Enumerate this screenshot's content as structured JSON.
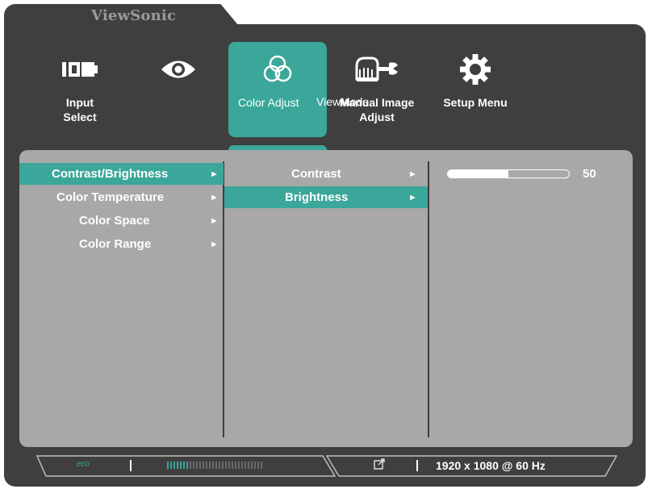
{
  "brand": "ViewSonic",
  "main_menu": [
    {
      "label": "Input\nSelect",
      "icon": "input-select-icon"
    },
    {
      "label": "",
      "icon": "eye-icon"
    },
    {
      "label": "Color Adjust",
      "icon": "color-circles-icon",
      "active": true
    },
    {
      "label": "ViewMode",
      "icon": "viewmode-icon"
    },
    {
      "label": "Manual Image\nAdjust",
      "icon": "hand-wrench-icon"
    },
    {
      "label": "Setup Menu",
      "icon": "gear-icon"
    }
  ],
  "submenu": [
    {
      "label": "Contrast/Brightness",
      "selected": true
    },
    {
      "label": "Color Temperature",
      "selected": false
    },
    {
      "label": "Color Space",
      "selected": false
    },
    {
      "label": "Color Range",
      "selected": false
    }
  ],
  "options": [
    {
      "label": "Contrast",
      "selected": false
    },
    {
      "label": "Brightness",
      "selected": true
    }
  ],
  "arrow": "►",
  "slider": {
    "value": "50",
    "fraction": 0.5
  },
  "status_bar": {
    "eco_label": "eco",
    "resolution": "1920 x 1080 @ 60 Hz",
    "link_icon": "link-out-icon"
  },
  "colors": {
    "accent": "#3aa79a",
    "frame": "#3f3f3f",
    "panel": "#a8a8a8"
  }
}
